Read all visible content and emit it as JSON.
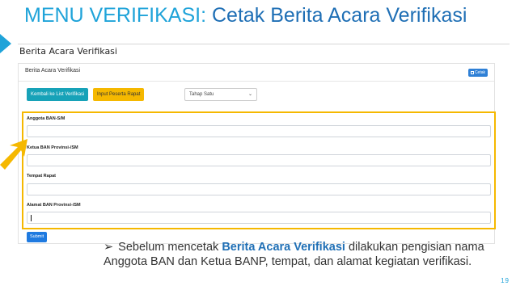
{
  "slide": {
    "title_part1": "MENU VERIFIKASI: ",
    "title_part2": "Cetak Berita Acara Verifikasi",
    "page_number": "19",
    "accent_color": "#1fa3d9",
    "highlight_color": "#f5b800"
  },
  "app": {
    "page_heading": "Berita Acara Verifikasi",
    "card_title": "Berita Acara Verifikasi",
    "print_label": "Cetak",
    "back_button": "Kembali ke List Verifikasi",
    "input_button": "Input Peserta Rapat",
    "tahap_select": "Tahap Satu",
    "fields": [
      {
        "label": "Anggota BAN-S/M",
        "value": ""
      },
      {
        "label": "Ketua BAN Provinsi-/SM",
        "value": ""
      },
      {
        "label": "Tempat Rapat",
        "value": ""
      },
      {
        "label": "Alamat BAN Provinsi-/SM",
        "value": ""
      }
    ],
    "submit_label": "Submit"
  },
  "note": {
    "bullet": "➢",
    "text_before": "Sebelum mencetak ",
    "text_highlight": "Berita Acara Verifikasi",
    "text_after": " dilakukan pengisian nama Anggota BAN dan Ketua BANP, tempat, dan alamat kegiatan verifikasi."
  }
}
